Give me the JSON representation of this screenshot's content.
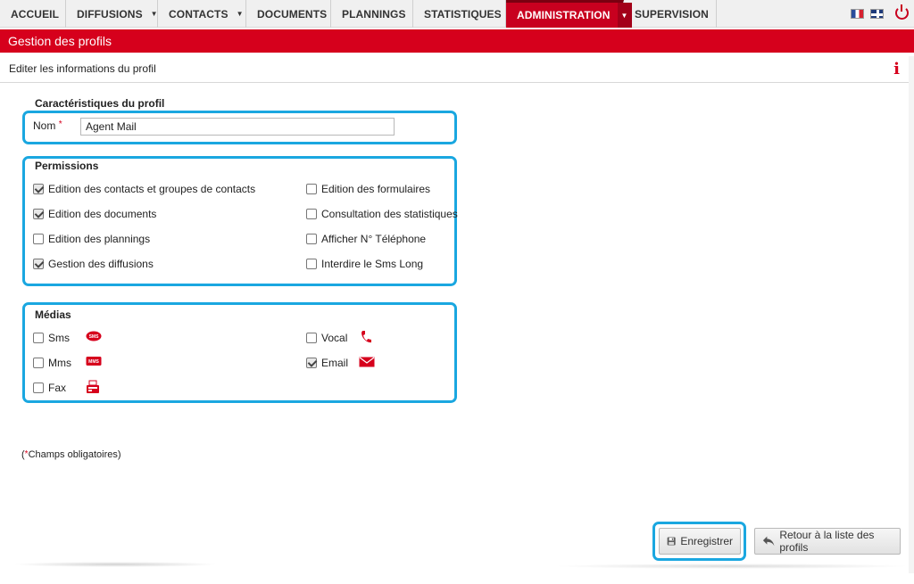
{
  "nav": {
    "tabs": [
      {
        "label": "ACCUEIL"
      },
      {
        "label": "DIFFUSIONS"
      },
      {
        "label": "CONTACTS"
      },
      {
        "label": "DOCUMENTS"
      },
      {
        "label": "PLANNINGS"
      },
      {
        "label": "STATISTIQUES"
      },
      {
        "label": "ADMINISTRATION"
      },
      {
        "label": "SUPERVISION"
      }
    ],
    "active_tab": "ADMINISTRATION",
    "caret": "▼"
  },
  "page": {
    "title": "Gestion des profils",
    "subtitle": "Editer les informations du profil",
    "info_glyph": "i"
  },
  "profile": {
    "section_title": "Caractéristiques du profil",
    "name_label": "Nom",
    "required_mark": "*",
    "name_value": "Agent Mail"
  },
  "permissions": {
    "section_title": "Permissions",
    "items": [
      {
        "label": "Edition des contacts et groupes de contacts",
        "checked": true
      },
      {
        "label": "Edition des documents",
        "checked": true
      },
      {
        "label": "Edition des plannings",
        "checked": false
      },
      {
        "label": "Gestion des diffusions",
        "checked": true
      },
      {
        "label": "Edition des formulaires",
        "checked": false
      },
      {
        "label": "Consultation des statistiques",
        "checked": false
      },
      {
        "label": "Afficher N° Téléphone",
        "checked": false
      },
      {
        "label": "Interdire le Sms Long",
        "checked": false
      }
    ]
  },
  "medias": {
    "section_title": "Médias",
    "items": [
      {
        "label": "Sms",
        "checked": false,
        "icon": "sms-icon",
        "icon_text": "SMS"
      },
      {
        "label": "Mms",
        "checked": false,
        "icon": "mms-icon",
        "icon_text": "MMS"
      },
      {
        "label": "Fax",
        "checked": false,
        "icon": "fax-icon",
        "icon_text": ""
      },
      {
        "label": "Vocal",
        "checked": false,
        "icon": "phone-icon",
        "icon_text": ""
      },
      {
        "label": "Email",
        "checked": true,
        "icon": "email-icon",
        "icon_text": ""
      }
    ]
  },
  "footer": {
    "required_note_star": "*",
    "required_note_text": "Champs obligatoires",
    "save_label": "Enregistrer",
    "back_label": "Retour à la liste des profils"
  },
  "colors": {
    "brand_red": "#d6001c",
    "highlight_blue": "#1aa7e0"
  }
}
